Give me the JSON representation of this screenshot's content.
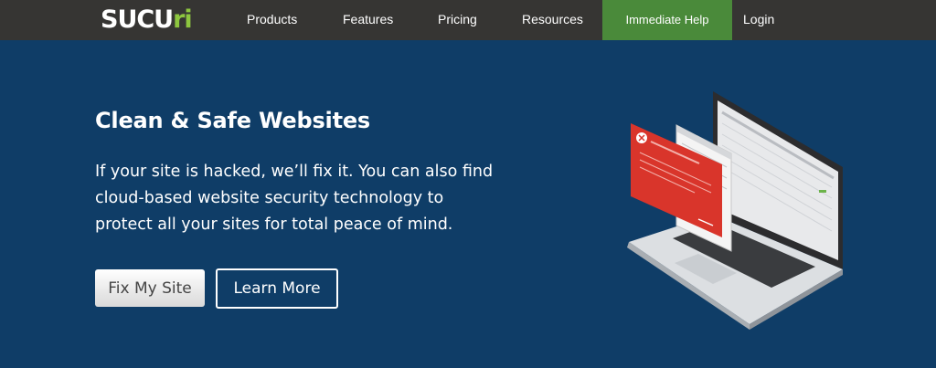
{
  "brand": {
    "name_main": "SUCU",
    "name_accent": "ri"
  },
  "nav": {
    "items": [
      {
        "label": "Products"
      },
      {
        "label": "Features"
      },
      {
        "label": "Pricing"
      },
      {
        "label": "Resources"
      }
    ],
    "help_label": "Immediate Help",
    "login_label": "Login"
  },
  "hero": {
    "title": "Clean & Safe Websites",
    "description": "If your site is hacked, we’ll fix it. You can also find cloud-based website security technology to protect all your sites for total peace of mind.",
    "primary_button": "Fix My Site",
    "secondary_button": "Learn More"
  },
  "colors": {
    "nav_bg": "#363533",
    "hero_bg": "#0f3d67",
    "help_green": "#4a8a3a",
    "alert_red": "#d9352b",
    "logo_green": "#8dc63f"
  }
}
